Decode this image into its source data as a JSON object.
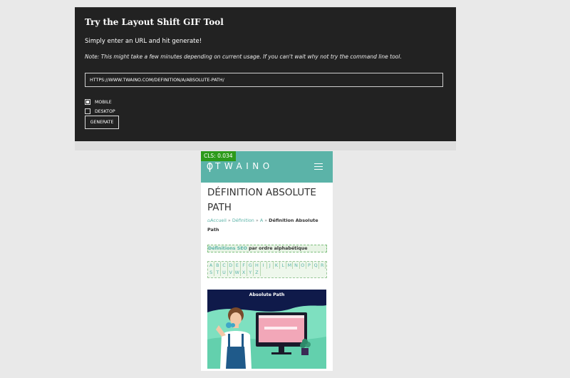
{
  "tool": {
    "title": "Try the Layout Shift GIF Tool",
    "subtitle": "Simply enter an URL and hit generate!",
    "note": "Note: This might take a few minutes depending on current usage. If you can't wait why not try the command line tool.",
    "url_value": "HTTPS://WWW.TWAINO.COM/DEFINITION/A/ABSOLUTE-PATH/",
    "options": [
      {
        "label": "MOBILE",
        "checked": true
      },
      {
        "label": "DESKTOP",
        "checked": false
      }
    ],
    "generate_label": "GENERATE"
  },
  "preview": {
    "cls_badge": "CLS: 0.034",
    "logo_text": "TWAINO",
    "heading": "DÉFINITION ABSOLUTE PATH",
    "breadcrumb": {
      "home": "Accueil",
      "sep1": " » ",
      "section": "Définition",
      "sep2": " » ",
      "letter": "A",
      "sep3": " » ",
      "current": "Définition Absolute Path"
    },
    "definitions_link": "Définitions SEO",
    "definitions_suffix": " par ordre alphabétique",
    "letters": [
      "A",
      "B",
      "C",
      "D",
      "E",
      "F",
      "G",
      "H",
      "I",
      "J",
      "K",
      "L",
      "M",
      "N",
      "O",
      "P",
      "Q",
      "R",
      "S",
      "T",
      "U",
      "V",
      "W",
      "X",
      "Y",
      "Z"
    ],
    "hero_title": "Absolute Path",
    "colors": {
      "header": "#5bb3a8",
      "badge": "#2c9a1a",
      "hero_bg": "#0f1a4a",
      "hero_mint": "#7ee0c0"
    }
  }
}
